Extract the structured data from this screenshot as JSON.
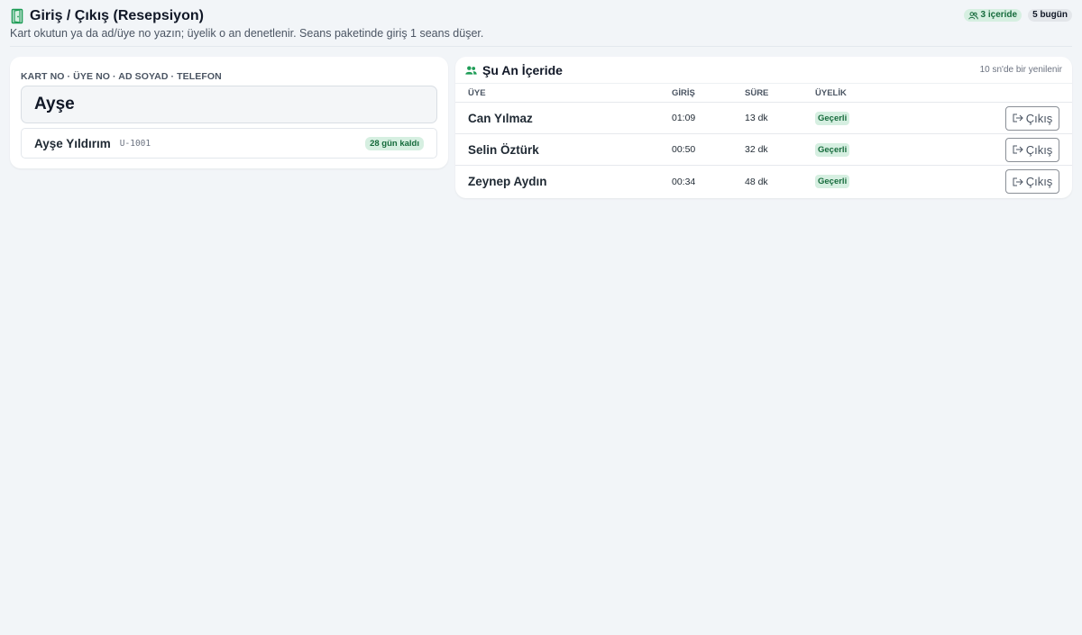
{
  "header": {
    "title": "Giriş / Çıkış (Resepsiyon)",
    "subtitle": "Kart okutun ya da ad/üye no yazın; üyelik o an denetlenir. Seans paketinde giriş 1 seans düşer.",
    "badge_inside": "3 içeride",
    "badge_today": "5 bugün"
  },
  "checkin": {
    "field_label": "KART NO · ÜYE NO · AD SOYAD · TELEFON",
    "input_value": "Ayşe",
    "results": [
      {
        "name": "Ayşe Yıldırım",
        "member_id": "U-1001",
        "remaining": "28 gün kaldı"
      }
    ]
  },
  "inside": {
    "title": "Şu An İçeride",
    "refresh_note": "10 sn'de bir yenilenir",
    "columns": {
      "member": "ÜYE",
      "entry": "GİRİŞ",
      "duration": "SÜRE",
      "membership": "ÜYELİK"
    },
    "rows": [
      {
        "name": "Can Yılmaz",
        "entry": "01:09",
        "duration": "13 dk",
        "status": "Geçerli",
        "action": "Çıkış"
      },
      {
        "name": "Selin Öztürk",
        "entry": "00:50",
        "duration": "32 dk",
        "status": "Geçerli",
        "action": "Çıkış"
      },
      {
        "name": "Zeynep Aydın",
        "entry": "00:34",
        "duration": "48 dk",
        "status": "Geçerli",
        "action": "Çıkış"
      }
    ]
  },
  "colors": {
    "accent_green": "#166b3c",
    "badge_green_bg": "#d6efe1",
    "background": "#f2f5f8"
  },
  "icons": {
    "title": "door-icon",
    "inside_badge": "users-icon",
    "panel": "users-icon",
    "checkout": "logout-icon"
  }
}
